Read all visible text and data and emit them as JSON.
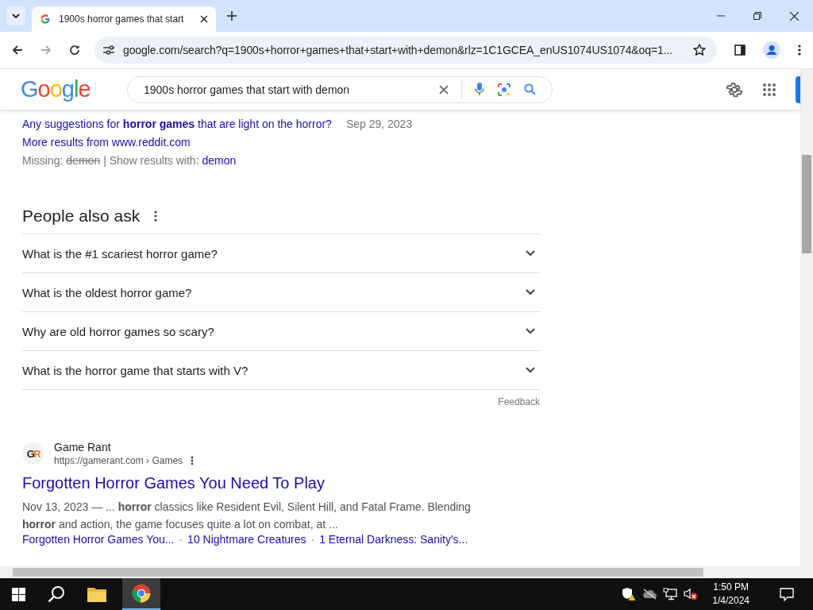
{
  "browser": {
    "tab": {
      "title": "1900s horror games that start",
      "selected": true
    },
    "address": "google.com/search?q=1900s+horror+games+that+start+with+demon&rlz=1C1GCEA_enUS1074US1074&oq=1..."
  },
  "search_header": {
    "logo": "Google",
    "query": "1900s horror games that start with demon"
  },
  "reddit_more": {
    "links": [
      {
        "text": "Any suggestions for **horror games** that are light on the horror?",
        "date": "Sep 29, 2023"
      }
    ],
    "more": "More results from www.reddit.com",
    "missing_label": "Missing:",
    "missing_term": "demon",
    "show_label": "| Show results with:",
    "show_term": "demon"
  },
  "people_also_ask": {
    "title": "People also ask",
    "questions": [
      {
        "text": "What is the #1 scariest horror game?",
        "expanded": false
      },
      {
        "text": "What is the oldest horror game?",
        "expanded": false
      },
      {
        "text": "Why are old horror games so scary?",
        "expanded": false
      },
      {
        "text": "What is the horror game that starts with V?",
        "expanded": false
      }
    ],
    "feedback": "Feedback"
  },
  "result": {
    "favicon": "GR",
    "site": "Game Rant",
    "url": "https://gamerant.com › Games",
    "title": "Forgotten Horror Games You Need To Play",
    "snippet": "Nov 13, 2023 — ... **horror** classics like Resident Evil, Silent Hill, and Fatal Frame. Blending **horror** and action, the game focuses quite a lot on combat, at ...",
    "separator": "·",
    "sitelinks": [
      "Forgotten Horror Games You...",
      "10 Nightmare Creatures",
      "1 Eternal Darkness: Sanity's..."
    ]
  },
  "taskbar": {
    "time": "1:50 PM",
    "date": "1/4/2024"
  }
}
